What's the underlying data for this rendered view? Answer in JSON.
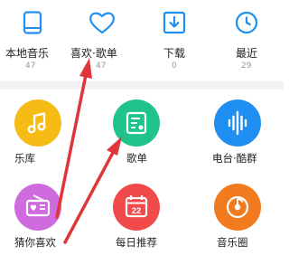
{
  "top_nav": [
    {
      "label": "本地音乐",
      "count": "47",
      "icon": "phone-icon"
    },
    {
      "label": "喜欢·歌单",
      "count": "47",
      "icon": "heart-icon"
    },
    {
      "label": "下载",
      "count": "0",
      "icon": "download-icon"
    },
    {
      "label": "最近",
      "count": "29",
      "icon": "clock-icon"
    }
  ],
  "tiles": [
    {
      "label": "乐库",
      "icon": "music-note-icon",
      "color": "#f6bb14"
    },
    {
      "label": "歌单",
      "icon": "playlist-icon",
      "color": "#20c48a"
    },
    {
      "label": "电台·酷群",
      "icon": "soundwave-icon",
      "color": "#1e8ff0"
    },
    {
      "label": "猜你喜欢",
      "icon": "radio-icon",
      "color": "#d06adf"
    },
    {
      "label": "每日推荐",
      "icon": "calendar-icon",
      "color": "#f04a4a",
      "badge": "22"
    },
    {
      "label": "音乐圈",
      "icon": "music-disc-icon",
      "color": "#f27b20"
    }
  ],
  "colors": {
    "top_icon": "#1e8ff0",
    "annotation_arrow": "#e0363a"
  }
}
